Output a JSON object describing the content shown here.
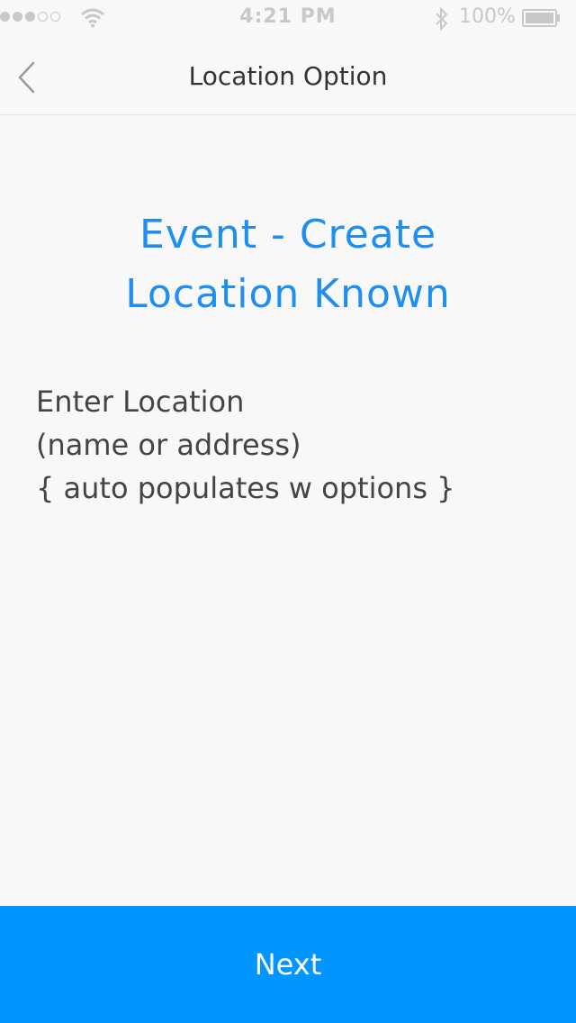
{
  "status_bar": {
    "time": "4:21 PM",
    "battery_percent": "100%",
    "signal_strength": 3,
    "signal_max": 5
  },
  "nav": {
    "title": "Location Option",
    "back_icon": "chevron-left-icon"
  },
  "heading": {
    "line1": "Event - Create",
    "line2": "Location Known"
  },
  "location_input": {
    "line1": "Enter Location",
    "line2": "(name or address)",
    "line3": "{ auto populates w options }"
  },
  "next_button": {
    "label": "Next"
  },
  "colors": {
    "accent": "#1f8ef1",
    "button": "#0095ff",
    "background": "#f8f8f8"
  }
}
